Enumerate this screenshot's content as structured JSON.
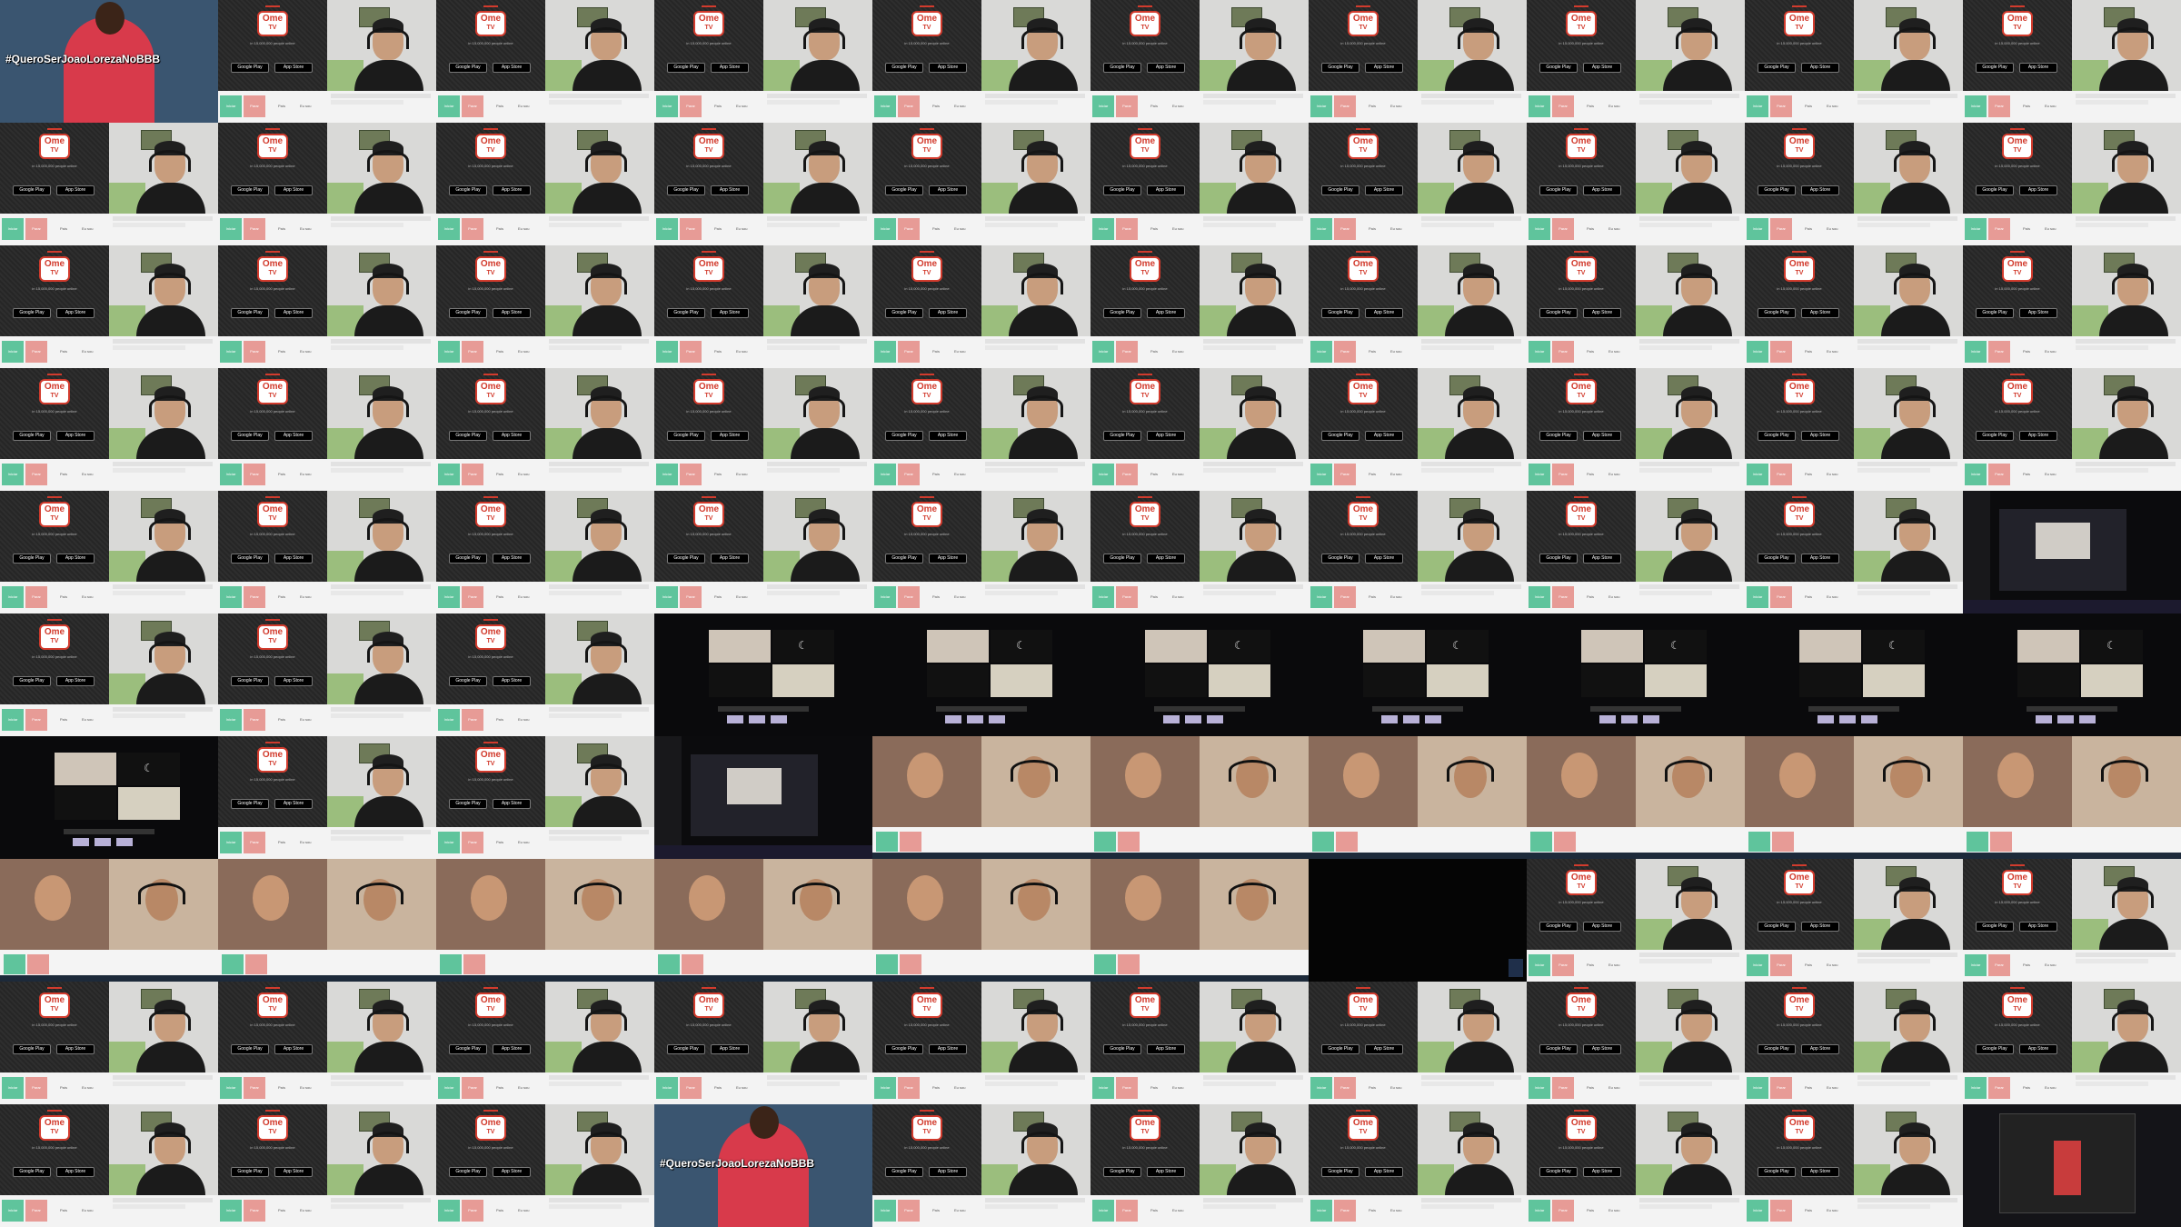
{
  "ome": {
    "logo_top": "Ome",
    "logo_bottom": "TV",
    "tagline": "in 15,000,000 people online",
    "google_play": "Google Play",
    "app_store": "App Store",
    "next_label": "Iniciar",
    "stop_label": "Parar",
    "country_label": "País",
    "gender_label": "Eu sou"
  },
  "dance": {
    "caption": "#QueroSerJoaoLorezaNoBBB"
  },
  "grid": {
    "columns": 10,
    "rows": 10,
    "tiles": [
      "dance",
      "ome",
      "ome",
      "ome",
      "ome",
      "ome",
      "ome",
      "ome",
      "ome",
      "ome",
      "ome",
      "ome",
      "ome",
      "ome",
      "ome",
      "ome",
      "ome",
      "ome",
      "ome",
      "ome",
      "ome",
      "ome",
      "ome",
      "ome",
      "ome",
      "ome",
      "ome",
      "ome",
      "ome",
      "ome",
      "ome",
      "ome",
      "ome",
      "ome",
      "ome",
      "ome",
      "ome",
      "ome",
      "ome",
      "ome",
      "ome",
      "ome",
      "ome",
      "ome",
      "ome",
      "ome",
      "ome",
      "ome",
      "ome",
      "dash",
      "ome",
      "ome",
      "ome",
      "grid4",
      "grid4",
      "grid4",
      "grid4",
      "grid4",
      "grid4",
      "grid4",
      "grid4",
      "ome",
      "ome",
      "dash",
      "vc",
      "vc",
      "vc",
      "vc",
      "vc",
      "vc",
      "vc",
      "vc",
      "vc",
      "vc",
      "vc",
      "vc",
      "black",
      "ome",
      "ome",
      "ome",
      "ome",
      "ome",
      "ome",
      "ome",
      "ome",
      "ome",
      "ome",
      "ome",
      "ome",
      "ome",
      "ome",
      "ome",
      "ome",
      "dance",
      "ome",
      "ome",
      "ome",
      "ome",
      "ome",
      "desk"
    ]
  }
}
